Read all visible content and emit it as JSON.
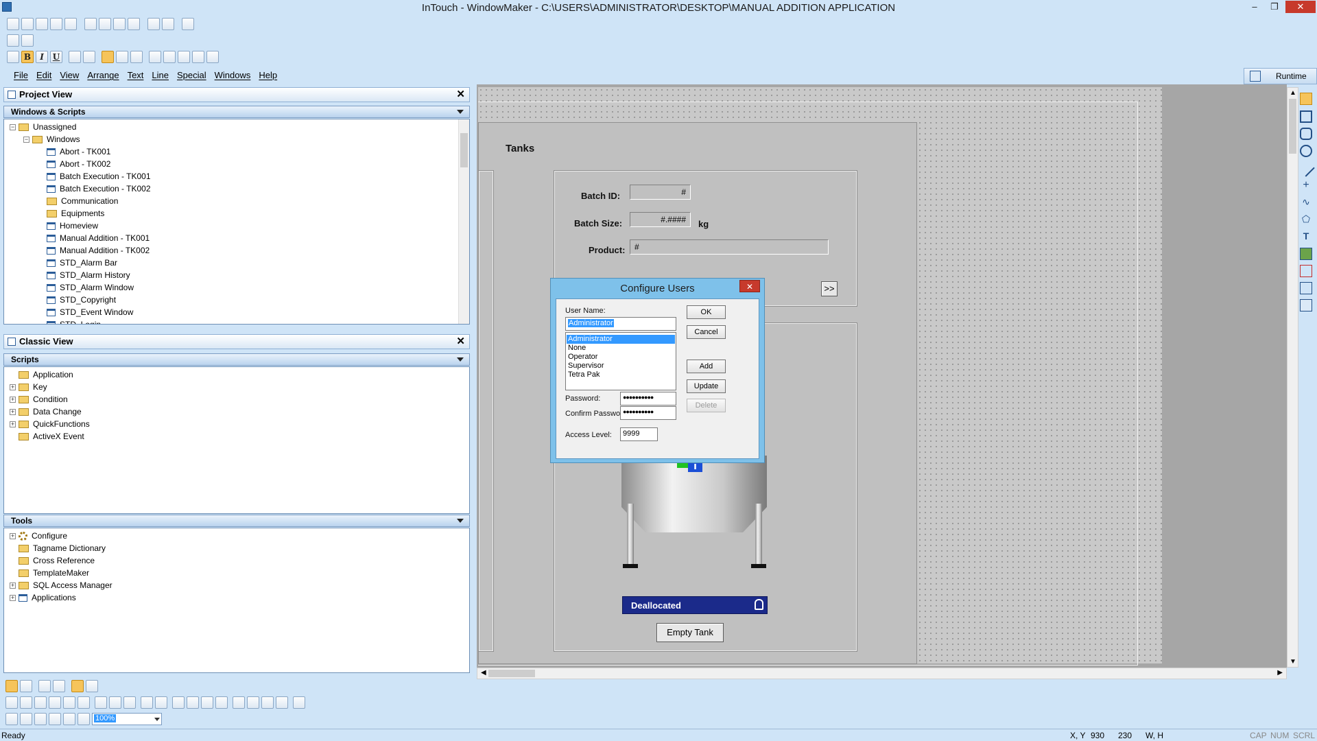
{
  "window": {
    "title": "InTouch - WindowMaker - C:\\USERS\\ADMINISTRATOR\\DESKTOP\\MANUAL ADDITION APPLICATION",
    "minimize": "–",
    "restore": "❐",
    "close": "✕"
  },
  "menu": [
    "File",
    "Edit",
    "View",
    "Arrange",
    "Text",
    "Line",
    "Special",
    "Windows",
    "Help"
  ],
  "format_buttons": {
    "bold": "B",
    "italic": "I",
    "underline": "U"
  },
  "runtime_button": "Runtime",
  "project_view": {
    "title": "Project View",
    "section": "Windows & Scripts",
    "root": "Unassigned",
    "folder": "Windows",
    "items": [
      {
        "label": "Abort - TK001",
        "icon": "window"
      },
      {
        "label": "Abort - TK002",
        "icon": "window"
      },
      {
        "label": "Batch Execution - TK001",
        "icon": "window"
      },
      {
        "label": "Batch Execution - TK002",
        "icon": "window"
      },
      {
        "label": "Communication",
        "icon": "folder"
      },
      {
        "label": "Equipments",
        "icon": "folder"
      },
      {
        "label": "Homeview",
        "icon": "window"
      },
      {
        "label": "Manual Addition - TK001",
        "icon": "window"
      },
      {
        "label": "Manual Addition - TK002",
        "icon": "window"
      },
      {
        "label": "STD_Alarm Bar",
        "icon": "window"
      },
      {
        "label": "STD_Alarm History",
        "icon": "window"
      },
      {
        "label": "STD_Alarm Window",
        "icon": "window"
      },
      {
        "label": "STD_Copyright",
        "icon": "window"
      },
      {
        "label": "STD_Event Window",
        "icon": "window"
      },
      {
        "label": "STD_Login",
        "icon": "window"
      }
    ]
  },
  "classic_view": {
    "title": "Classic View",
    "scripts_section": "Scripts",
    "scripts": [
      "Application",
      "Key",
      "Condition",
      "Data Change",
      "QuickFunctions",
      "ActiveX Event"
    ],
    "tools_section": "Tools",
    "tools": [
      "Configure",
      "Tagname Dictionary",
      "Cross Reference",
      "TemplateMaker",
      "SQL Access Manager",
      "Applications"
    ]
  },
  "canvas": {
    "heading": "Tanks",
    "batch_id_label": "Batch ID:",
    "batch_id_value": "#",
    "batch_size_label": "Batch Size:",
    "batch_size_value": "#.####",
    "batch_size_unit": "kg",
    "product_label": "Product:",
    "product_value": "#",
    "next_button": ">>",
    "status_bar_text": "Deallocated",
    "empty_tank_button": "Empty Tank"
  },
  "dialog": {
    "title": "Configure Users",
    "close": "✕",
    "user_name_label": "User Name:",
    "user_name_value": "Administrator",
    "users": [
      "Administrator",
      "None",
      "Operator",
      "Supervisor",
      "Tetra Pak"
    ],
    "password_label": "Password:",
    "password_value": "●●●●●●●●●●",
    "confirm_label": "Confirm Password:",
    "confirm_value": "●●●●●●●●●●",
    "access_label": "Access Level:",
    "access_value": "9999",
    "ok": "OK",
    "cancel": "Cancel",
    "add": "Add",
    "update": "Update",
    "delete": "Delete"
  },
  "zoom": "100%",
  "status": {
    "left": "Ready",
    "xy_label": "X, Y",
    "x": "930",
    "y": "230",
    "wh_label": "W, H",
    "cap": "CAP",
    "num": "NUM",
    "scrl": "SCRL"
  },
  "colors": {
    "chrome": "#cfe4f7",
    "dialog_frame": "#7ec1ea",
    "selection": "#3399ff",
    "status_banner": "#1b2a8a"
  }
}
